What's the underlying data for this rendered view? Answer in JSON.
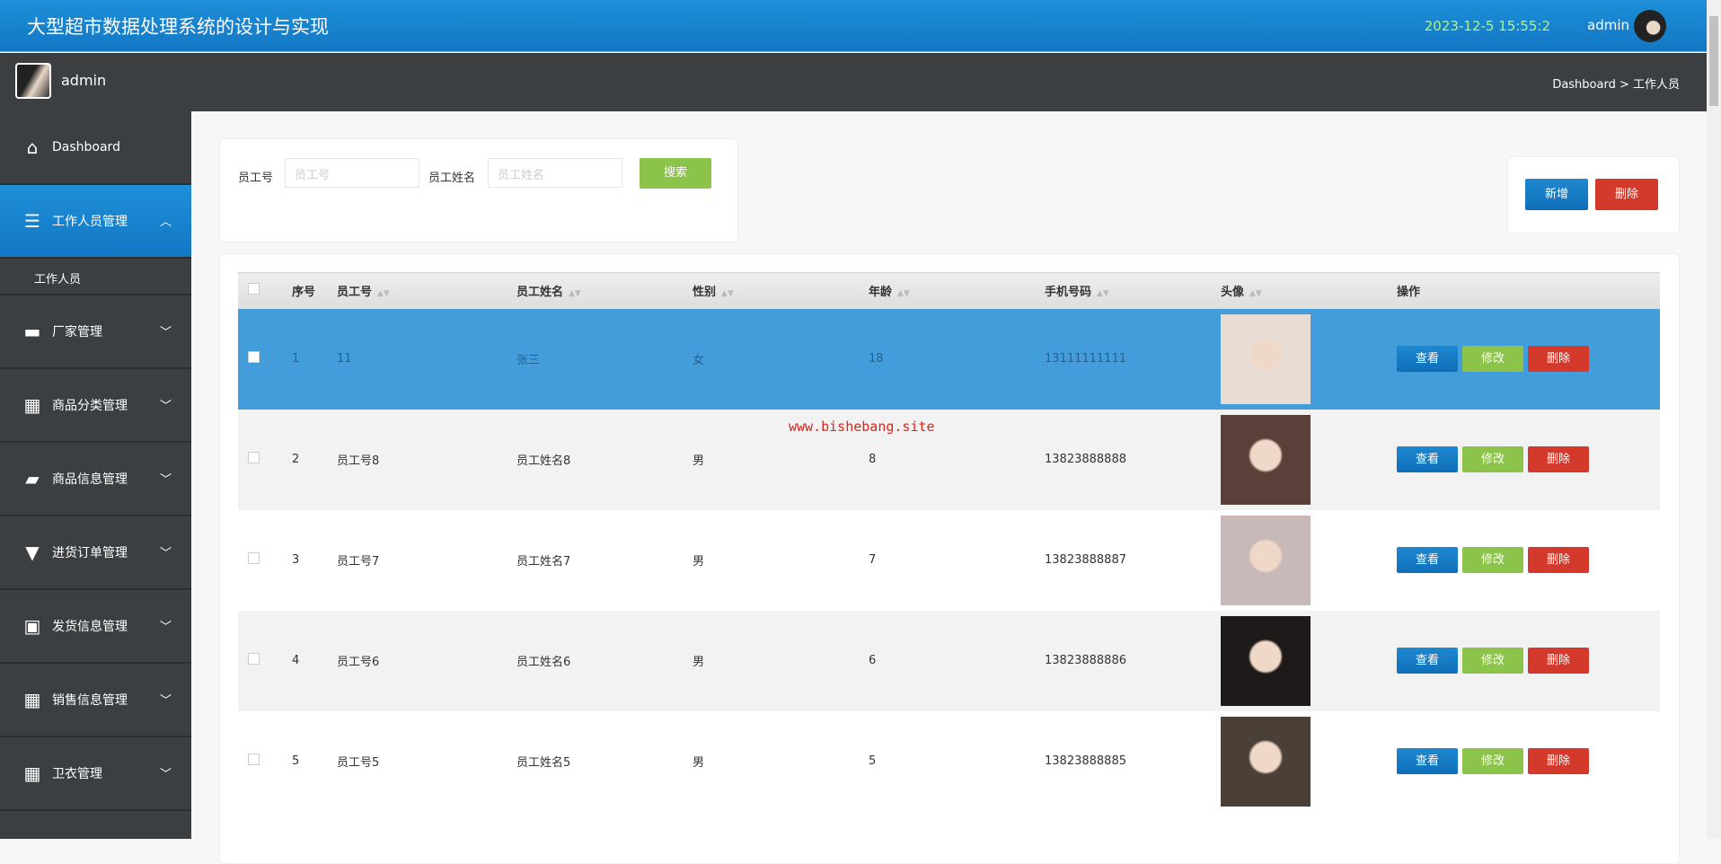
{
  "header": {
    "title": "大型超市数据处理系统的设计与实现",
    "datetime": "2023-12-5 15:55:2",
    "user": "admin"
  },
  "subbar": {
    "user": "admin",
    "breadcrumb": "Dashboard > 工作人员"
  },
  "sidebar": {
    "items": [
      {
        "label": "Dashboard",
        "icon": "home-icon",
        "glyph": "⌂"
      },
      {
        "label": "工作人员管理",
        "icon": "sliders-icon",
        "glyph": "☰",
        "active": true,
        "sub": [
          "工作人员"
        ]
      },
      {
        "label": "厂家管理",
        "icon": "factory-icon",
        "glyph": "▬"
      },
      {
        "label": "商品分类管理",
        "icon": "grid-icon",
        "glyph": "▦"
      },
      {
        "label": "商品信息管理",
        "icon": "ticket-icon",
        "glyph": "▰"
      },
      {
        "label": "进货订单管理",
        "icon": "brush-icon",
        "glyph": "▼"
      },
      {
        "label": "发货信息管理",
        "icon": "briefcase-icon",
        "glyph": "▣"
      },
      {
        "label": "销售信息管理",
        "icon": "grid-icon",
        "glyph": "▦"
      },
      {
        "label": "卫衣管理",
        "icon": "grid-icon",
        "glyph": "▦"
      }
    ]
  },
  "search": {
    "emp_no_label": "员工号",
    "emp_no_placeholder": "员工号",
    "emp_name_label": "员工姓名",
    "emp_name_placeholder": "员工姓名",
    "search_button": "搜索"
  },
  "actions": {
    "add": "新增",
    "delete": "删除"
  },
  "table": {
    "headers": [
      "序号",
      "员工号",
      "员工姓名",
      "性别",
      "年龄",
      "手机号码",
      "头像",
      "操作"
    ],
    "rows": [
      {
        "idx": "1",
        "no": "11",
        "name": "张三",
        "sex": "女",
        "age": "18",
        "phone": "13111111111",
        "photo_color": "#e8ddd5"
      },
      {
        "idx": "2",
        "no": "员工号8",
        "name": "员工姓名8",
        "sex": "男",
        "age": "8",
        "phone": "13823888888",
        "photo_color": "#5a4038"
      },
      {
        "idx": "3",
        "no": "员工号7",
        "name": "员工姓名7",
        "sex": "男",
        "age": "7",
        "phone": "13823888887",
        "photo_color": "#c8b8b8"
      },
      {
        "idx": "4",
        "no": "员工号6",
        "name": "员工姓名6",
        "sex": "男",
        "age": "6",
        "phone": "13823888886",
        "photo_color": "#1e1a1a"
      },
      {
        "idx": "5",
        "no": "员工号5",
        "name": "员工姓名5",
        "sex": "男",
        "age": "5",
        "phone": "13823888885",
        "photo_color": "#4a4038"
      }
    ],
    "ops": {
      "view": "查看",
      "edit": "修改",
      "delete": "删除"
    }
  },
  "watermark": "www.bishebang.site"
}
